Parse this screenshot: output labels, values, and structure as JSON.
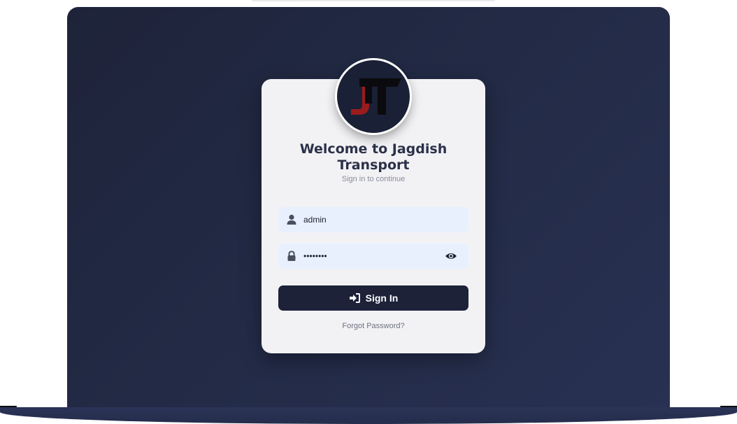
{
  "login": {
    "title_line1": "Welcome to Jagdish",
    "title_line2": "Transport",
    "subtitle": "Sign in to continue",
    "username_value": "admin",
    "password_value": "••••••••",
    "sign_in_label": "Sign In",
    "forgot_label": "Forgot Password?"
  },
  "icons": {
    "username": "user-icon",
    "password": "lock-icon",
    "show_password": "eye-icon",
    "sign_in": "sign-in-icon"
  },
  "colors": {
    "background": "#222a45",
    "card": "#f2f2f5",
    "field": "#e8f0fe",
    "button": "#1d2239",
    "logo_red": "#9b1c1c"
  }
}
